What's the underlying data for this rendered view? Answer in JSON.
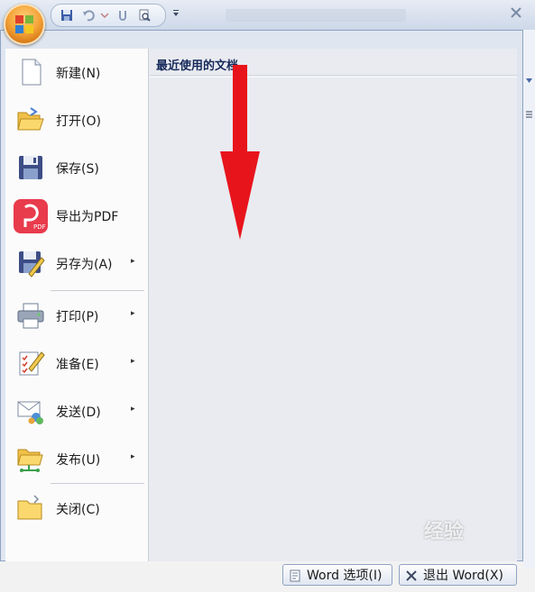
{
  "menu": {
    "items": [
      {
        "label": "新建(N)",
        "icon": "new-document-icon",
        "has_submenu": false
      },
      {
        "label": "打开(O)",
        "icon": "open-folder-icon",
        "has_submenu": false
      },
      {
        "label": "保存(S)",
        "icon": "save-disk-icon",
        "has_submenu": false
      },
      {
        "label": "导出为PDF",
        "icon": "pdf-export-icon",
        "has_submenu": false
      },
      {
        "label": "另存为(A)",
        "icon": "save-as-icon",
        "has_submenu": true
      },
      {
        "label": "打印(P)",
        "icon": "printer-icon",
        "has_submenu": true
      },
      {
        "label": "准备(E)",
        "icon": "prepare-icon",
        "has_submenu": true
      },
      {
        "label": "发送(D)",
        "icon": "send-icon",
        "has_submenu": true
      },
      {
        "label": "发布(U)",
        "icon": "publish-icon",
        "has_submenu": true
      },
      {
        "label": "关闭(C)",
        "icon": "close-folder-icon",
        "has_submenu": false
      }
    ],
    "submenu_arrow": "▸"
  },
  "recent": {
    "title": "最近使用的文档"
  },
  "buttons": {
    "options_label": "Word 选项(I)",
    "exit_label": "退出 Word(X)"
  },
  "watermark": "经验",
  "colors": {
    "accent_orange": "#f4a338",
    "arrow_red": "#e8141c",
    "pdf_red": "#e83b4c",
    "frame_blue": "#8ea2c2"
  }
}
